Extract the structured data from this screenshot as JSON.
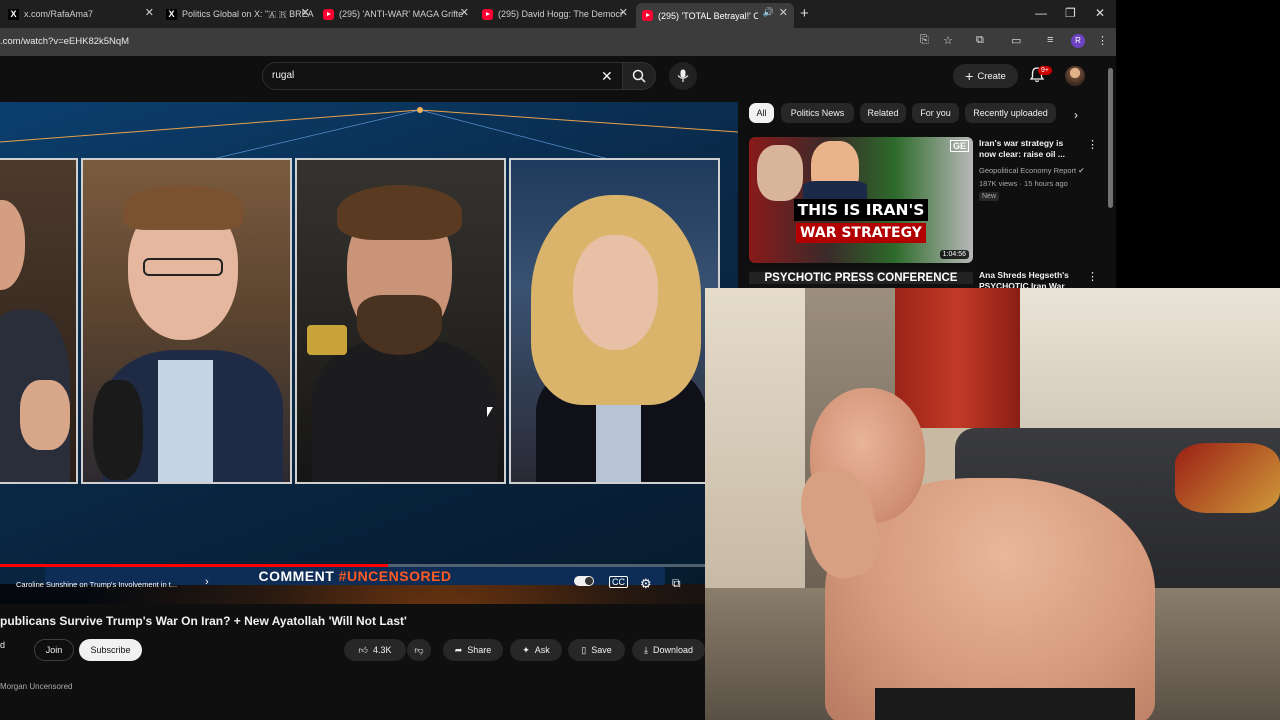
{
  "tabs": [
    {
      "label": "x.com/RafaAma7",
      "icon": "x-icon"
    },
    {
      "label": "Politics Global on X: \"🇦 🇷 BREA",
      "icon": "x-icon"
    },
    {
      "label": "(295) 'ANTI-WAR' MAGA Grifte",
      "icon": "youtube-icon"
    },
    {
      "label": "(295) David Hogg: The Democr",
      "icon": "youtube-icon"
    },
    {
      "label": "(295) 'TOTAL Betrayal!' Can",
      "icon": "youtube-icon",
      "active": true
    }
  ],
  "address": {
    "url": ".com/watch?v=eEHK82k5NqM",
    "profile_initial": "R"
  },
  "header": {
    "search_value": "rugal",
    "create_label": "Create",
    "notification_count": "9+"
  },
  "player": {
    "banner_left": "COMMENT",
    "banner_right": "#UNCENSORED",
    "chapter": "Caroline Sunshine on Trump's Involvement in t...",
    "progress": 0.55
  },
  "video": {
    "title": "publicans Survive Trump's War On Iran? + New Ayatollah 'Will Not Last'",
    "channel_fragment": "d",
    "join_label": "Join",
    "subscribe_label": "Subscribe",
    "like_count": "4.3K",
    "share_label": "Share",
    "ask_label": "Ask",
    "save_label": "Save",
    "download_label": "Download",
    "description_fragment": "Morgan Uncensored"
  },
  "sidebar": {
    "chips": [
      "All",
      "Politics News",
      "Related",
      "For you",
      "Recently uploaded"
    ],
    "recommendations": [
      {
        "title": "Iran's war strategy is now clear: raise oil ...",
        "channel": "Geopolitical Economy Report",
        "meta": "187K views · 15 hours ago",
        "badge": "New",
        "duration": "1:04:56",
        "thumb_line1": "THIS IS IRAN'S",
        "thumb_line2": "WAR STRATEGY",
        "thumb_corner": "GE"
      },
      {
        "title": "Ana Shreds Hegseth's PSYCHOTIC Iran War",
        "thumb_line1": "PSYCHOTIC PRESS CONFERENCE"
      }
    ]
  }
}
